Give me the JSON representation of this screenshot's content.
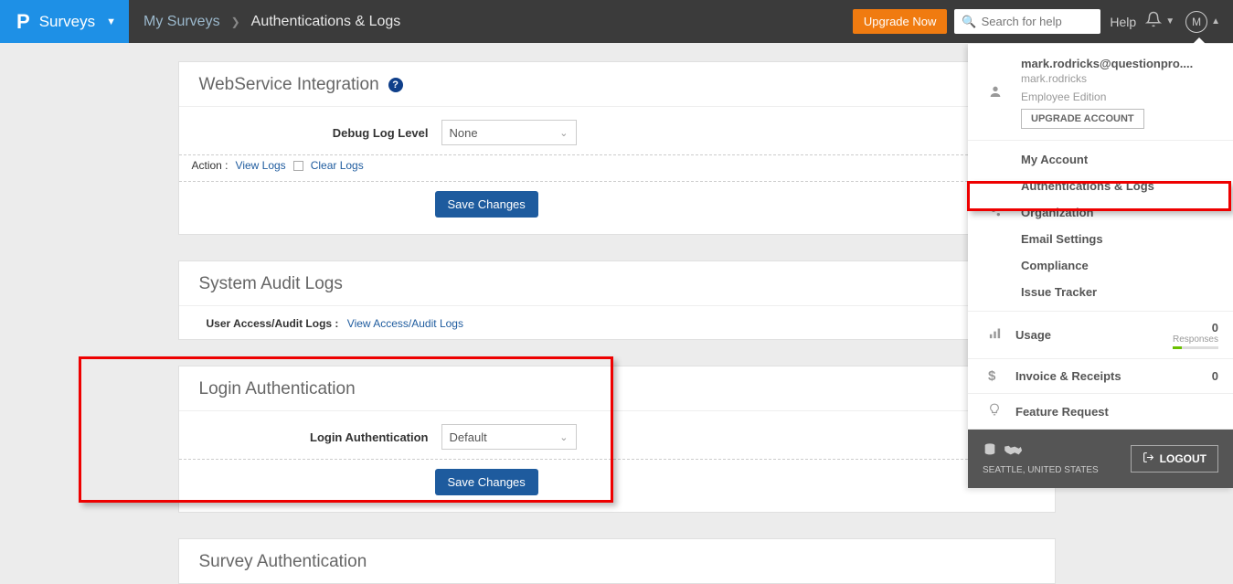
{
  "topbar": {
    "brand": "Surveys",
    "breadcrumb_link": "My Surveys",
    "breadcrumb_current": "Authentications & Logs",
    "upgrade": "Upgrade Now",
    "search_placeholder": "Search for help",
    "help": "Help",
    "avatar_letter": "M"
  },
  "panels": {
    "webservice": {
      "title": "WebService Integration",
      "debug_label": "Debug Log Level",
      "debug_value": "None",
      "action_label": "Action :",
      "view_logs": "View Logs",
      "clear_logs": "Clear Logs",
      "save": "Save Changes"
    },
    "audit": {
      "title": "System Audit Logs",
      "label": "User Access/Audit Logs :",
      "link": "View Access/Audit Logs"
    },
    "login": {
      "title": "Login Authentication",
      "label": "Login Authentication",
      "value": "Default",
      "save": "Save Changes"
    },
    "survey_auth": {
      "title": "Survey Authentication"
    }
  },
  "dropdown": {
    "email": "mark.rodricks@questionpro....",
    "username": "mark.rodricks",
    "edition": "Employee Edition",
    "upgrade_account": "UPGRADE ACCOUNT",
    "settings": {
      "my_account": "My Account",
      "auth_logs": "Authentications & Logs",
      "organization": "Organization",
      "email_settings": "Email Settings",
      "compliance": "Compliance",
      "issue_tracker": "Issue Tracker"
    },
    "usage": {
      "label": "Usage",
      "value": "0",
      "sub": "Responses"
    },
    "invoice": {
      "label": "Invoice & Receipts",
      "value": "0"
    },
    "feature": {
      "label": "Feature Request"
    },
    "location": "SEATTLE, UNITED STATES",
    "logout": "LOGOUT"
  }
}
